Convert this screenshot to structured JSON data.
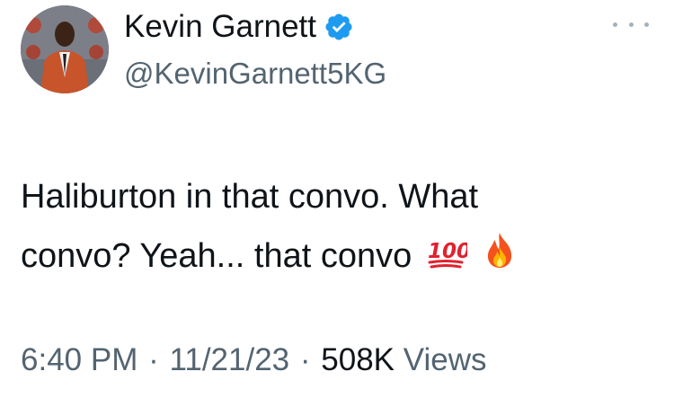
{
  "author": {
    "display_name": "Kevin Garnett",
    "handle": "@KevinGarnett5KG",
    "avatar_icon": "profile-photo",
    "verified_icon": "verified-badge-icon",
    "verified_color": "#1d9bf0"
  },
  "tweet": {
    "line1": "Haliburton in that convo. What",
    "line2": "convo? Yeah... that convo",
    "emojis": [
      "hundred-points-emoji",
      "fire-emoji"
    ]
  },
  "meta": {
    "time": "6:40 PM",
    "date": "11/21/23",
    "separator": "·",
    "views_count": "508K",
    "views_label": "Views"
  },
  "menu": {
    "icon": "more-options-icon"
  }
}
